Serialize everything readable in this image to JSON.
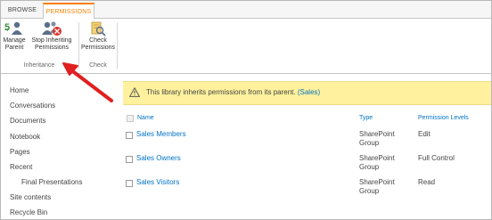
{
  "ribbon": {
    "tabs": [
      {
        "label": "BROWSE"
      },
      {
        "label": "PERMISSIONS"
      }
    ],
    "buttons": {
      "manage_parent": {
        "line1": "Manage",
        "line2": "Parent"
      },
      "stop_inheriting": {
        "line1": "Stop Inheriting",
        "line2": "Permissions"
      },
      "check_permissions": {
        "line1": "Check",
        "line2": "Permissions"
      }
    },
    "groups": {
      "inheritance": "Inheritance",
      "check": "Check"
    }
  },
  "nav": {
    "items": [
      {
        "label": "Home"
      },
      {
        "label": "Conversations"
      },
      {
        "label": "Documents"
      },
      {
        "label": "Notebook"
      },
      {
        "label": "Pages"
      },
      {
        "label": "Recent"
      },
      {
        "label": "Final Presentations"
      },
      {
        "label": "Site contents"
      },
      {
        "label": "Recycle Bin"
      }
    ]
  },
  "notice": {
    "text": "This library inherits permissions from its parent.",
    "link": "(Sales)"
  },
  "table": {
    "columns": {
      "name": "Name",
      "type": "Type",
      "levels": "Permission Levels"
    },
    "rows": [
      {
        "name": "Sales Members",
        "type_line1": "SharePoint",
        "type_line2": "Group",
        "level": "Edit"
      },
      {
        "name": "Sales Owners",
        "type_line1": "SharePoint",
        "type_line2": "Group",
        "level": "Full Control"
      },
      {
        "name": "Sales Visitors",
        "type_line1": "SharePoint",
        "type_line2": "Group",
        "level": "Read"
      }
    ]
  },
  "colors": {
    "accent": "#ff7f00",
    "link": "#0072c6",
    "notice_bg": "#fff19d",
    "arrow": "#e02020"
  },
  "icons": [
    "manage-parent-icon",
    "stop-inheriting-icon",
    "check-permissions-icon",
    "warning-icon",
    "red-arrow"
  ]
}
